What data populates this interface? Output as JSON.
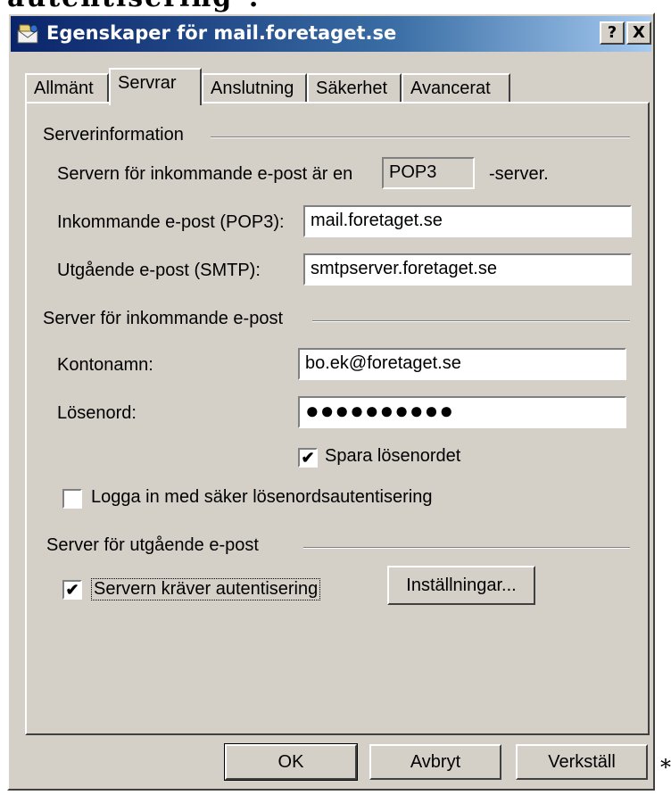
{
  "window": {
    "title": "Egenskaper för mail.foretaget.se",
    "help_label": "?",
    "close_label": "X"
  },
  "tabs": [
    {
      "label": "Allmänt"
    },
    {
      "label": "Servrar"
    },
    {
      "label": "Anslutning"
    },
    {
      "label": "Säkerhet"
    },
    {
      "label": "Avancerat"
    }
  ],
  "serverinfo": {
    "group_label": "Serverinformation",
    "incoming_type_prefix": "Servern för inkommande e-post är en",
    "incoming_type_value": "POP3",
    "incoming_type_suffix": "-server.",
    "incoming_label": "Inkommande e-post (POP3):",
    "incoming_value": "mail.foretaget.se",
    "outgoing_label": "Utgående e-post (SMTP):",
    "outgoing_value": "smtpserver.foretaget.se"
  },
  "incoming_server": {
    "group_label": "Server för inkommande e-post",
    "account_label": "Kontonamn:",
    "account_value": "bo.ek@foretaget.se",
    "password_label": "Lösenord:",
    "password_value": "●●●●●●●●●●",
    "remember_label": "Spara lösenordet",
    "remember_checked": true,
    "spa_label": "Logga in med säker lösenordsautentisering",
    "spa_checked": false
  },
  "outgoing_server": {
    "group_label": "Server för utgående e-post",
    "auth_label": "Servern kräver autentisering",
    "auth_checked": true,
    "settings_button": "Inställningar..."
  },
  "buttons": {
    "ok": "OK",
    "cancel": "Avbryt",
    "apply": "Verkställ"
  },
  "page_text": {
    "top_clipped": "autentisering\".",
    "right_mark": "*"
  }
}
